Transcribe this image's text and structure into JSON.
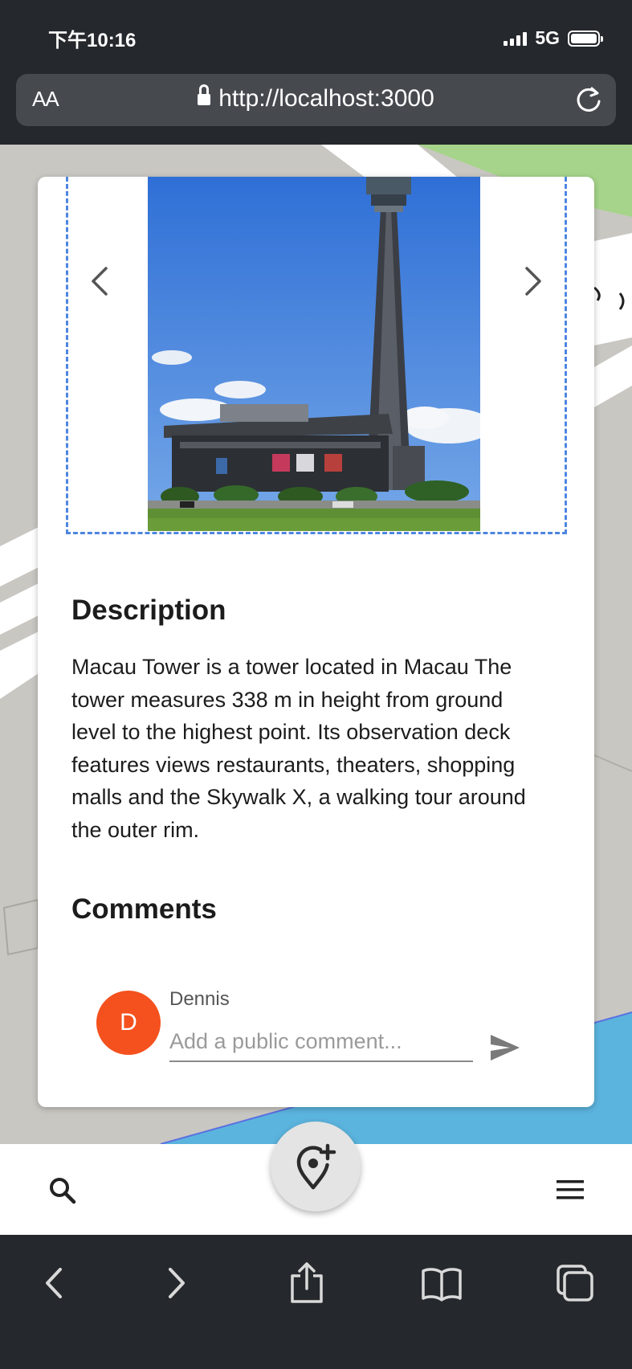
{
  "status_bar": {
    "time": "下午10:16",
    "network": "5G"
  },
  "browser": {
    "text_size_label": "AA",
    "url": "http://localhost:3000"
  },
  "card": {
    "description_title": "Description",
    "description_text": "Macau Tower is a tower located in Macau The tower measures 338 m in height from ground level to the highest point. Its observation deck features views restaurants, theaters, shopping malls and the Skywalk X, a walking tour around the outer rim.",
    "comments_title": "Comments",
    "comment_form": {
      "user_name": "Dennis",
      "avatar_initial": "D",
      "avatar_color": "#f4511e",
      "placeholder": "Add a public comment..."
    }
  },
  "icons": {
    "carousel": [
      "chevron-left-icon",
      "chevron-right-icon"
    ],
    "app_bar": [
      "search-icon",
      "add-location-icon",
      "menu-icon"
    ],
    "browser_toolbar": [
      "back-icon",
      "forward-icon",
      "share-icon",
      "bookmarks-icon",
      "tabs-icon"
    ]
  },
  "colors": {
    "accent_dashed": "#4e86e0",
    "chrome": "#25282c"
  }
}
